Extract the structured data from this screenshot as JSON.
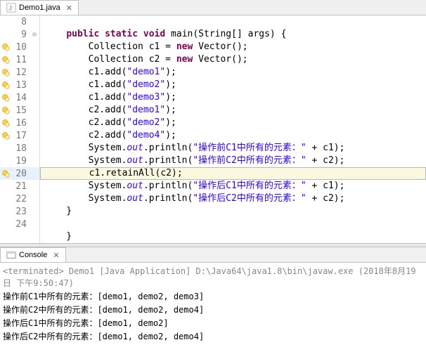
{
  "tab": {
    "filename": "Demo1.java",
    "close": "✕"
  },
  "lines": [
    {
      "n": "8",
      "marker": "",
      "fold": "",
      "hl": false,
      "box": false,
      "segs": []
    },
    {
      "n": "9",
      "marker": "",
      "fold": "⊖",
      "hl": false,
      "box": false,
      "segs": [
        {
          "t": "    ",
          "c": ""
        },
        {
          "t": "public",
          "c": "kw"
        },
        {
          "t": " ",
          "c": ""
        },
        {
          "t": "static",
          "c": "kw"
        },
        {
          "t": " ",
          "c": ""
        },
        {
          "t": "void",
          "c": "kw"
        },
        {
          "t": " main(String[] args) {",
          "c": ""
        }
      ]
    },
    {
      "n": "10",
      "marker": "warn",
      "fold": "",
      "hl": false,
      "box": false,
      "segs": [
        {
          "t": "        Collection c1 = ",
          "c": ""
        },
        {
          "t": "new",
          "c": "kw"
        },
        {
          "t": " Vector();",
          "c": ""
        }
      ]
    },
    {
      "n": "11",
      "marker": "warn",
      "fold": "",
      "hl": false,
      "box": false,
      "segs": [
        {
          "t": "        Collection c2 = ",
          "c": ""
        },
        {
          "t": "new",
          "c": "kw"
        },
        {
          "t": " Vector();",
          "c": ""
        }
      ]
    },
    {
      "n": "12",
      "marker": "warn",
      "fold": "",
      "hl": false,
      "box": false,
      "segs": [
        {
          "t": "        c1.add(",
          "c": ""
        },
        {
          "t": "\"demo1\"",
          "c": "str"
        },
        {
          "t": ");",
          "c": ""
        }
      ]
    },
    {
      "n": "13",
      "marker": "warn",
      "fold": "",
      "hl": false,
      "box": false,
      "segs": [
        {
          "t": "        c1.add(",
          "c": ""
        },
        {
          "t": "\"demo2\"",
          "c": "str"
        },
        {
          "t": ");",
          "c": ""
        }
      ]
    },
    {
      "n": "14",
      "marker": "warn",
      "fold": "",
      "hl": false,
      "box": false,
      "segs": [
        {
          "t": "        c1.add(",
          "c": ""
        },
        {
          "t": "\"demo3\"",
          "c": "str"
        },
        {
          "t": ");",
          "c": ""
        }
      ]
    },
    {
      "n": "15",
      "marker": "warn",
      "fold": "",
      "hl": false,
      "box": false,
      "segs": [
        {
          "t": "        c2.add(",
          "c": ""
        },
        {
          "t": "\"demo1\"",
          "c": "str"
        },
        {
          "t": ");",
          "c": ""
        }
      ]
    },
    {
      "n": "16",
      "marker": "warn",
      "fold": "",
      "hl": false,
      "box": false,
      "segs": [
        {
          "t": "        c2.add(",
          "c": ""
        },
        {
          "t": "\"demo2\"",
          "c": "str"
        },
        {
          "t": ");",
          "c": ""
        }
      ]
    },
    {
      "n": "17",
      "marker": "warn",
      "fold": "",
      "hl": false,
      "box": false,
      "segs": [
        {
          "t": "        c2.add(",
          "c": ""
        },
        {
          "t": "\"demo4\"",
          "c": "str"
        },
        {
          "t": ");",
          "c": ""
        }
      ]
    },
    {
      "n": "18",
      "marker": "",
      "fold": "",
      "hl": false,
      "box": false,
      "segs": [
        {
          "t": "        System.",
          "c": ""
        },
        {
          "t": "out",
          "c": "sf"
        },
        {
          "t": ".println(",
          "c": ""
        },
        {
          "t": "\"操作前C1中所有的元素：\"",
          "c": "str"
        },
        {
          "t": " + c1);",
          "c": ""
        }
      ]
    },
    {
      "n": "19",
      "marker": "",
      "fold": "",
      "hl": false,
      "box": false,
      "segs": [
        {
          "t": "        System.",
          "c": ""
        },
        {
          "t": "out",
          "c": "sf"
        },
        {
          "t": ".println(",
          "c": ""
        },
        {
          "t": "\"操作前C2中所有的元素：\"",
          "c": "str"
        },
        {
          "t": " + c2);",
          "c": ""
        }
      ]
    },
    {
      "n": "20",
      "marker": "warn",
      "fold": "",
      "hl": true,
      "box": true,
      "segs": [
        {
          "t": "        c1.retainAll(c2);",
          "c": ""
        }
      ]
    },
    {
      "n": "21",
      "marker": "",
      "fold": "",
      "hl": false,
      "box": false,
      "segs": [
        {
          "t": "        System.",
          "c": ""
        },
        {
          "t": "out",
          "c": "sf"
        },
        {
          "t": ".println(",
          "c": ""
        },
        {
          "t": "\"操作后C1中所有的元素：\"",
          "c": "str"
        },
        {
          "t": " + c1);",
          "c": ""
        }
      ]
    },
    {
      "n": "22",
      "marker": "",
      "fold": "",
      "hl": false,
      "box": false,
      "segs": [
        {
          "t": "        System.",
          "c": ""
        },
        {
          "t": "out",
          "c": "sf"
        },
        {
          "t": ".println(",
          "c": ""
        },
        {
          "t": "\"操作后C2中所有的元素：\"",
          "c": "str"
        },
        {
          "t": " + c2);",
          "c": ""
        }
      ]
    },
    {
      "n": "23",
      "marker": "",
      "fold": "",
      "hl": false,
      "box": false,
      "segs": [
        {
          "t": "    }",
          "c": ""
        }
      ]
    },
    {
      "n": "24",
      "marker": "",
      "fold": "",
      "hl": false,
      "box": false,
      "segs": []
    },
    {
      "n": "",
      "marker": "",
      "fold": "",
      "hl": false,
      "box": false,
      "segs": [
        {
          "t": "    }",
          "c": ""
        }
      ]
    }
  ],
  "console": {
    "tab_label": "Console",
    "close": "✕",
    "terminated": "<terminated> Demo1 [Java Application] D:\\Java64\\java1.8\\bin\\javaw.exe (2018年8月19日 下午9:50:47)",
    "output": [
      "操作前C1中所有的元素：[demo1, demo2, demo3]",
      "操作前C2中所有的元素：[demo1, demo2, demo4]",
      "操作后C1中所有的元素：[demo1, demo2]",
      "操作后C2中所有的元素：[demo1, demo2, demo4]"
    ]
  }
}
